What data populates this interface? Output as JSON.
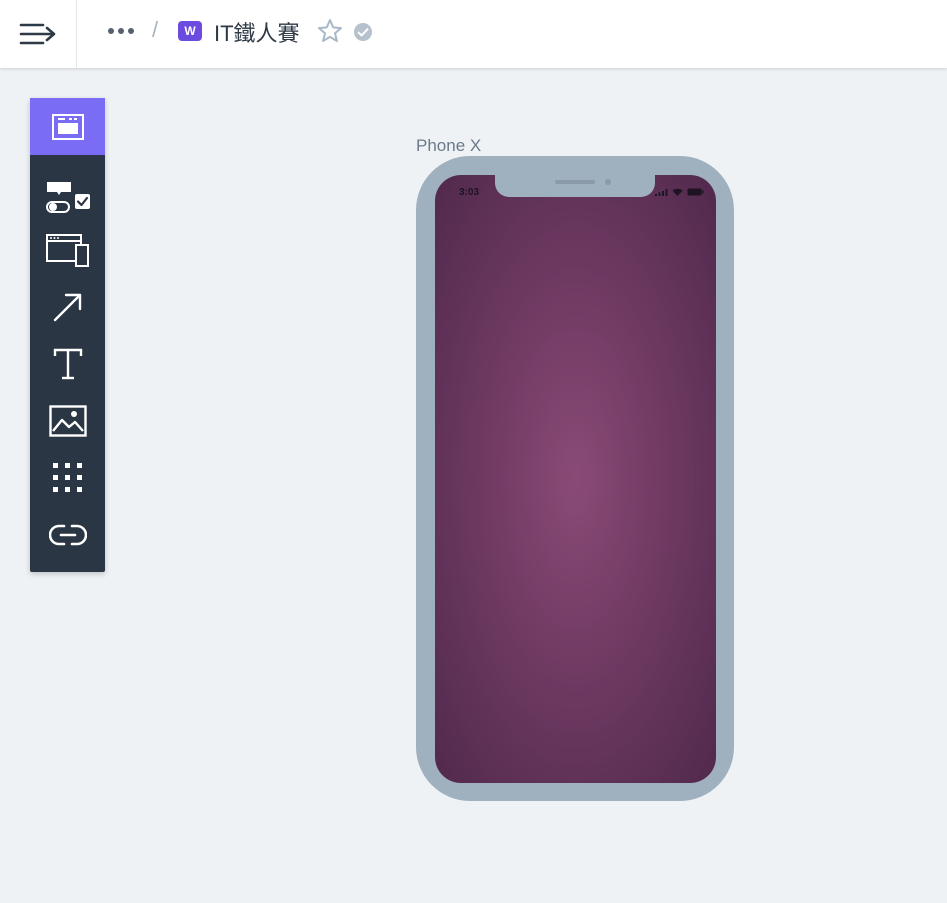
{
  "header": {
    "breadcrumb_more_icon": "more-horizontal-icon",
    "separator": "/",
    "workspace_badge": "W",
    "project_title": "IT鐵人賽",
    "brand_color": "#6c4bdf"
  },
  "toolbar": {
    "active_color": "#7b6cf6",
    "items": [
      {
        "icon": "screen-icon",
        "active": true
      },
      {
        "icon": "form-elements-icon",
        "active": false
      },
      {
        "icon": "devices-icon",
        "active": false
      },
      {
        "icon": "arrow-icon",
        "active": false
      },
      {
        "icon": "text-icon",
        "active": false
      },
      {
        "icon": "image-icon",
        "active": false
      },
      {
        "icon": "grid-icon",
        "active": false
      },
      {
        "icon": "link-icon",
        "active": false
      }
    ]
  },
  "canvas": {
    "device_label": "Phone X",
    "status_time": "3:03"
  }
}
